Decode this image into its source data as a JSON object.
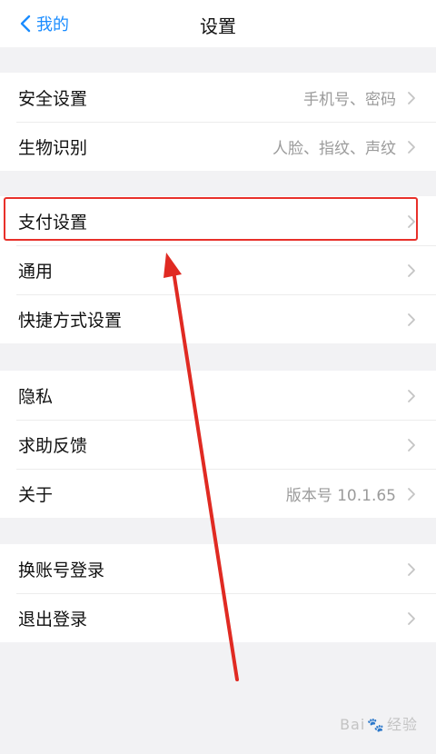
{
  "nav": {
    "back_label": "我的",
    "title": "设置"
  },
  "groups": [
    {
      "rows": [
        {
          "label": "安全设置",
          "value": "手机号、密码"
        },
        {
          "label": "生物识别",
          "value": "人脸、指纹、声纹"
        }
      ]
    },
    {
      "rows": [
        {
          "label": "支付设置",
          "value": ""
        },
        {
          "label": "通用",
          "value": ""
        },
        {
          "label": "快捷方式设置",
          "value": ""
        }
      ]
    },
    {
      "rows": [
        {
          "label": "隐私",
          "value": ""
        },
        {
          "label": "求助反馈",
          "value": ""
        },
        {
          "label": "关于",
          "value": "版本号 10.1.65"
        }
      ]
    },
    {
      "rows": [
        {
          "label": "换账号登录",
          "value": ""
        },
        {
          "label": "退出登录",
          "value": ""
        }
      ]
    }
  ],
  "watermark": {
    "text_left": "Bai",
    "text_right": "经验"
  },
  "colors": {
    "accent": "#1a8cff",
    "highlight": "#e8302a",
    "arrow": "#e02a22"
  }
}
